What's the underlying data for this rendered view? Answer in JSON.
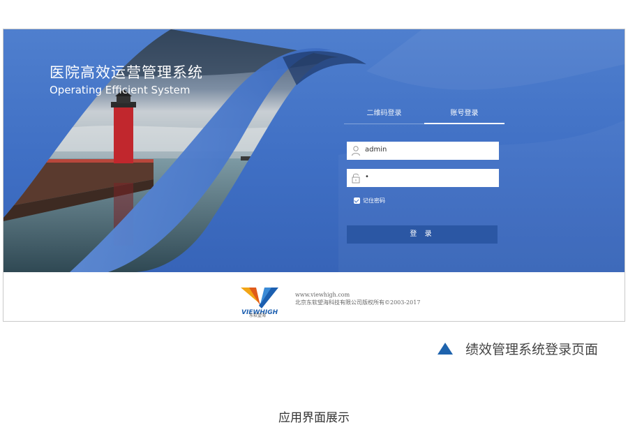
{
  "app": {
    "title_cn": "医院高效运营管理系统",
    "title_en": "Operating Efficient System"
  },
  "login": {
    "tabs": [
      {
        "label": "二维码登录",
        "active": false
      },
      {
        "label": "账号登录",
        "active": true
      }
    ],
    "username_value": "admin",
    "password_value": "•",
    "remember_label": "记住密码",
    "remember_checked": true,
    "submit_label": "登 录"
  },
  "footer": {
    "logo_text": "VIEWHIGH",
    "logo_sub": "东软望海",
    "website": "www.viewhigh.com",
    "copyright": "北京东软望海科技有限公司版权所有©2003-2017"
  },
  "caption": {
    "text": "绩效管理系统登录页面",
    "marker_color": "#1e63ad"
  },
  "section_label": "应用界面展示",
  "icons": {
    "username": "user-icon",
    "password": "lock-icon",
    "remember": "checkbox-checked-icon",
    "caption": "triangle-up-icon"
  },
  "colors": {
    "hero_blue": "#3f6fc4",
    "button_blue": "#2b57a4"
  }
}
